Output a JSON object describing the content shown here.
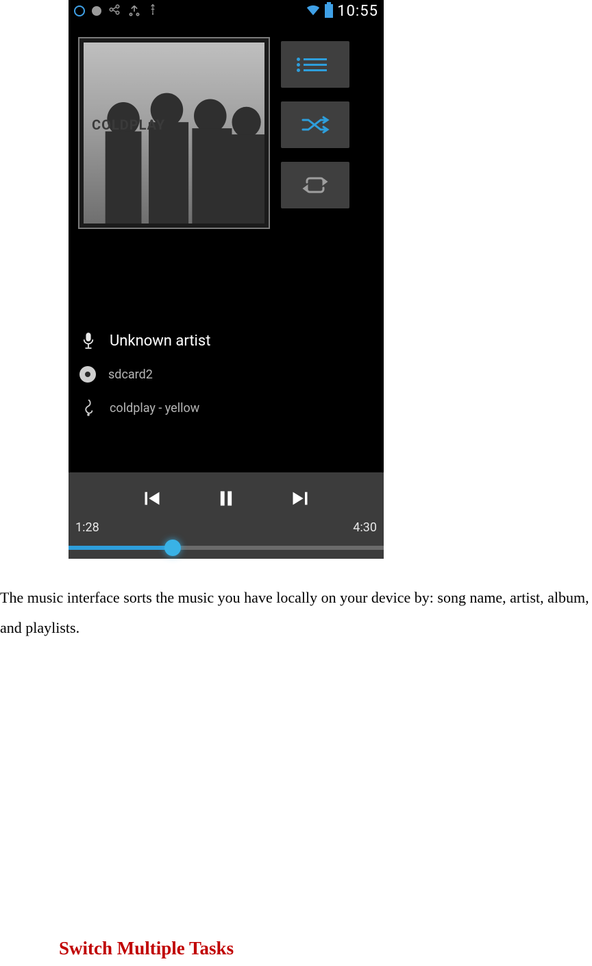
{
  "statusbar": {
    "icons": [
      "globe-icon",
      "dot-icon",
      "share-icon",
      "usb-icon",
      "wifi-icon",
      "battery-icon"
    ],
    "time": "10:55"
  },
  "album": {
    "title": "COLDPLAY"
  },
  "side_buttons": {
    "list": {
      "name": "playlist-button",
      "active": true
    },
    "shuffle": {
      "name": "shuffle-button",
      "active": true
    },
    "repeat": {
      "name": "repeat-button",
      "active": false
    }
  },
  "meta": {
    "artist": "Unknown artist",
    "source": "sdcard2",
    "track": "coldplay - yellow"
  },
  "playback": {
    "elapsed": "1:28",
    "total": "4:30",
    "progress_pct": 33
  },
  "controls": {
    "prev": "previous-track-button",
    "playpause": "pause-button",
    "next": "next-track-button"
  },
  "document": {
    "paragraph": "The music interface sorts the music you have locally on your device by: song name, artist, album, and playlists.",
    "heading": "Switch Multiple Tasks"
  }
}
